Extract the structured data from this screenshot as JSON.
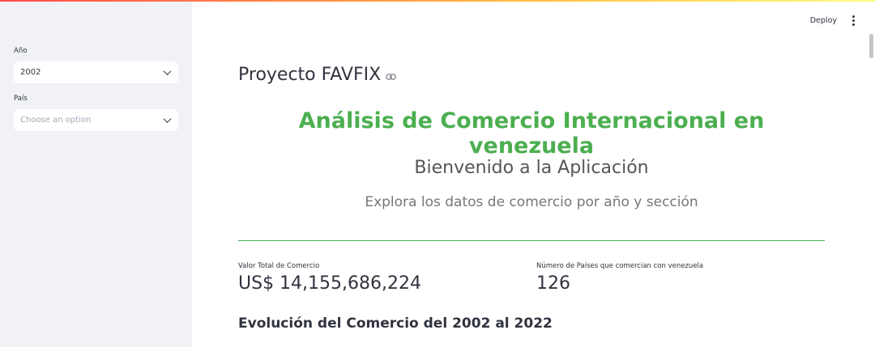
{
  "sidebar": {
    "year": {
      "label": "Año",
      "value": "2002"
    },
    "country": {
      "label": "País",
      "placeholder": "Choose an option"
    }
  },
  "header": {
    "deploy_label": "Deploy"
  },
  "main": {
    "title": "Proyecto FAVFIX",
    "headline": "Análisis de Comercio Internacional en venezuela",
    "welcome": "Bienvenido a la Aplicación",
    "subtitle": "Explora los datos de comercio por año y sección",
    "metrics": [
      {
        "label": "Valor Total de Comercio",
        "value": "US$ 14,155,686,224"
      },
      {
        "label": "Número de Países que comercian con venezuela",
        "value": "126"
      }
    ],
    "section_title": "Evolución del Comercio del 2002 al 2022"
  },
  "colors": {
    "headline_green": "#4caf50",
    "sidebar_bg": "#f0f2f6",
    "text": "#31333f"
  }
}
